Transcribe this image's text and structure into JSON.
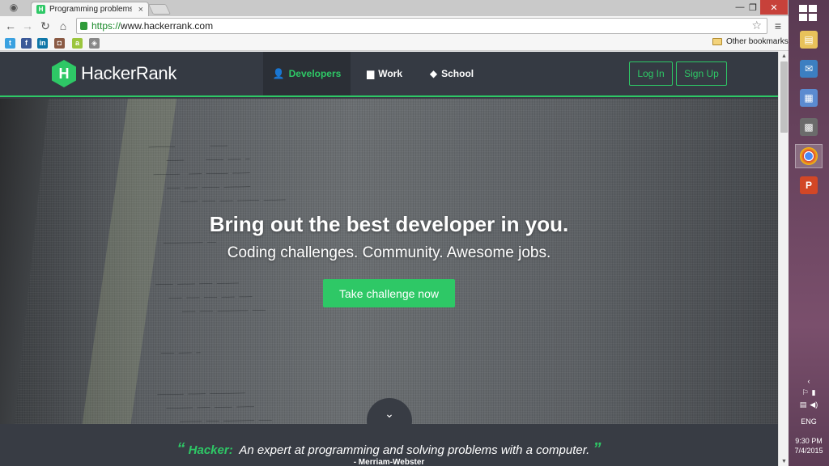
{
  "browser": {
    "tab_title": "Programming problems a",
    "tab_favicon_letter": "H",
    "url_scheme": "https://",
    "url_host": "www.hackerrank.com",
    "other_bookmarks": "Other bookmarks",
    "bookmarks": [
      {
        "icon": "twitter-icon",
        "color": "#3aa1e0"
      },
      {
        "icon": "facebook-icon",
        "color": "#3b5998"
      },
      {
        "icon": "linkedin-icon",
        "color": "#0e76a8"
      },
      {
        "icon": "instagram-icon",
        "color": "#8a5a44"
      },
      {
        "icon": "android-icon",
        "color": "#9bc53d"
      },
      {
        "icon": "compass-icon",
        "color": "#666666"
      }
    ]
  },
  "site": {
    "logo_text": "HackerRank",
    "logo_letter": "H",
    "nav": {
      "developers": "Developers",
      "work": "Work",
      "school": "School",
      "login": "Log In",
      "signup": "Sign Up"
    },
    "hero": {
      "title": "Bring out the best developer in you.",
      "subtitle": "Coding challenges. Community. Awesome jobs.",
      "cta": "Take challenge now"
    },
    "quote": {
      "open_mark": "“",
      "term": "Hacker:",
      "text": "An expert at programming and solving problems with a computer.",
      "close_mark": "”",
      "source": "- Merriam-Webster"
    },
    "accent_color": "#2ec866"
  },
  "taskbar": {
    "apps": [
      "file-explorer-icon",
      "mail-icon",
      "control-panel-icon",
      "calculator-icon",
      "chrome-icon",
      "powerpoint-icon"
    ],
    "language": "ENG",
    "time": "9:30 PM",
    "date": "7/4/2015"
  }
}
